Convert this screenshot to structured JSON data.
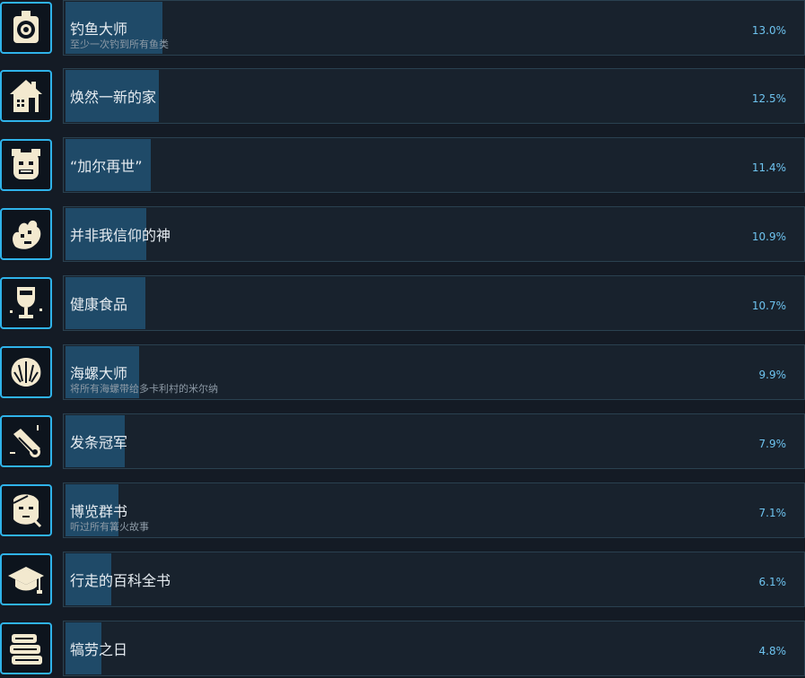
{
  "achievements": [
    {
      "name": "钓鱼大师",
      "desc": "至少一次钓到所有鱼类",
      "percent_label": "13.0%",
      "percent": 13.0,
      "icon": "compass-icon"
    },
    {
      "name": "焕然一新的家",
      "desc": "",
      "percent_label": "12.5%",
      "percent": 12.5,
      "icon": "house-icon"
    },
    {
      "name": "“加尔再世”",
      "desc": "",
      "percent_label": "11.4%",
      "percent": 11.4,
      "icon": "grinning-face-icon"
    },
    {
      "name": "并非我信仰的神",
      "desc": "",
      "percent_label": "10.9%",
      "percent": 10.9,
      "icon": "tentacle-icon"
    },
    {
      "name": "健康食品",
      "desc": "",
      "percent_label": "10.7%",
      "percent": 10.7,
      "icon": "goblet-icon"
    },
    {
      "name": "海螺大师",
      "desc": "将所有海螺带给多卡利村的米尔纳",
      "percent_label": "9.9%",
      "percent": 9.9,
      "icon": "seashell-icon"
    },
    {
      "name": "发条冠军",
      "desc": "",
      "percent_label": "7.9%",
      "percent": 7.9,
      "icon": "scroll-icon"
    },
    {
      "name": "博览群书",
      "desc": "听过所有篝火故事",
      "percent_label": "7.1%",
      "percent": 7.1,
      "icon": "reader-face-icon"
    },
    {
      "name": "行走的百科全书",
      "desc": "",
      "percent_label": "6.1%",
      "percent": 6.1,
      "icon": "graduation-cap-icon"
    },
    {
      "name": "犒劳之日",
      "desc": "",
      "percent_label": "4.8%",
      "percent": 4.8,
      "icon": "towel-stack-icon"
    }
  ],
  "colors": {
    "accent": "#2fb3ea",
    "bar": "#1f4a68",
    "percent": "#6ec4f0",
    "icon_fill": "#f3e9cf"
  }
}
